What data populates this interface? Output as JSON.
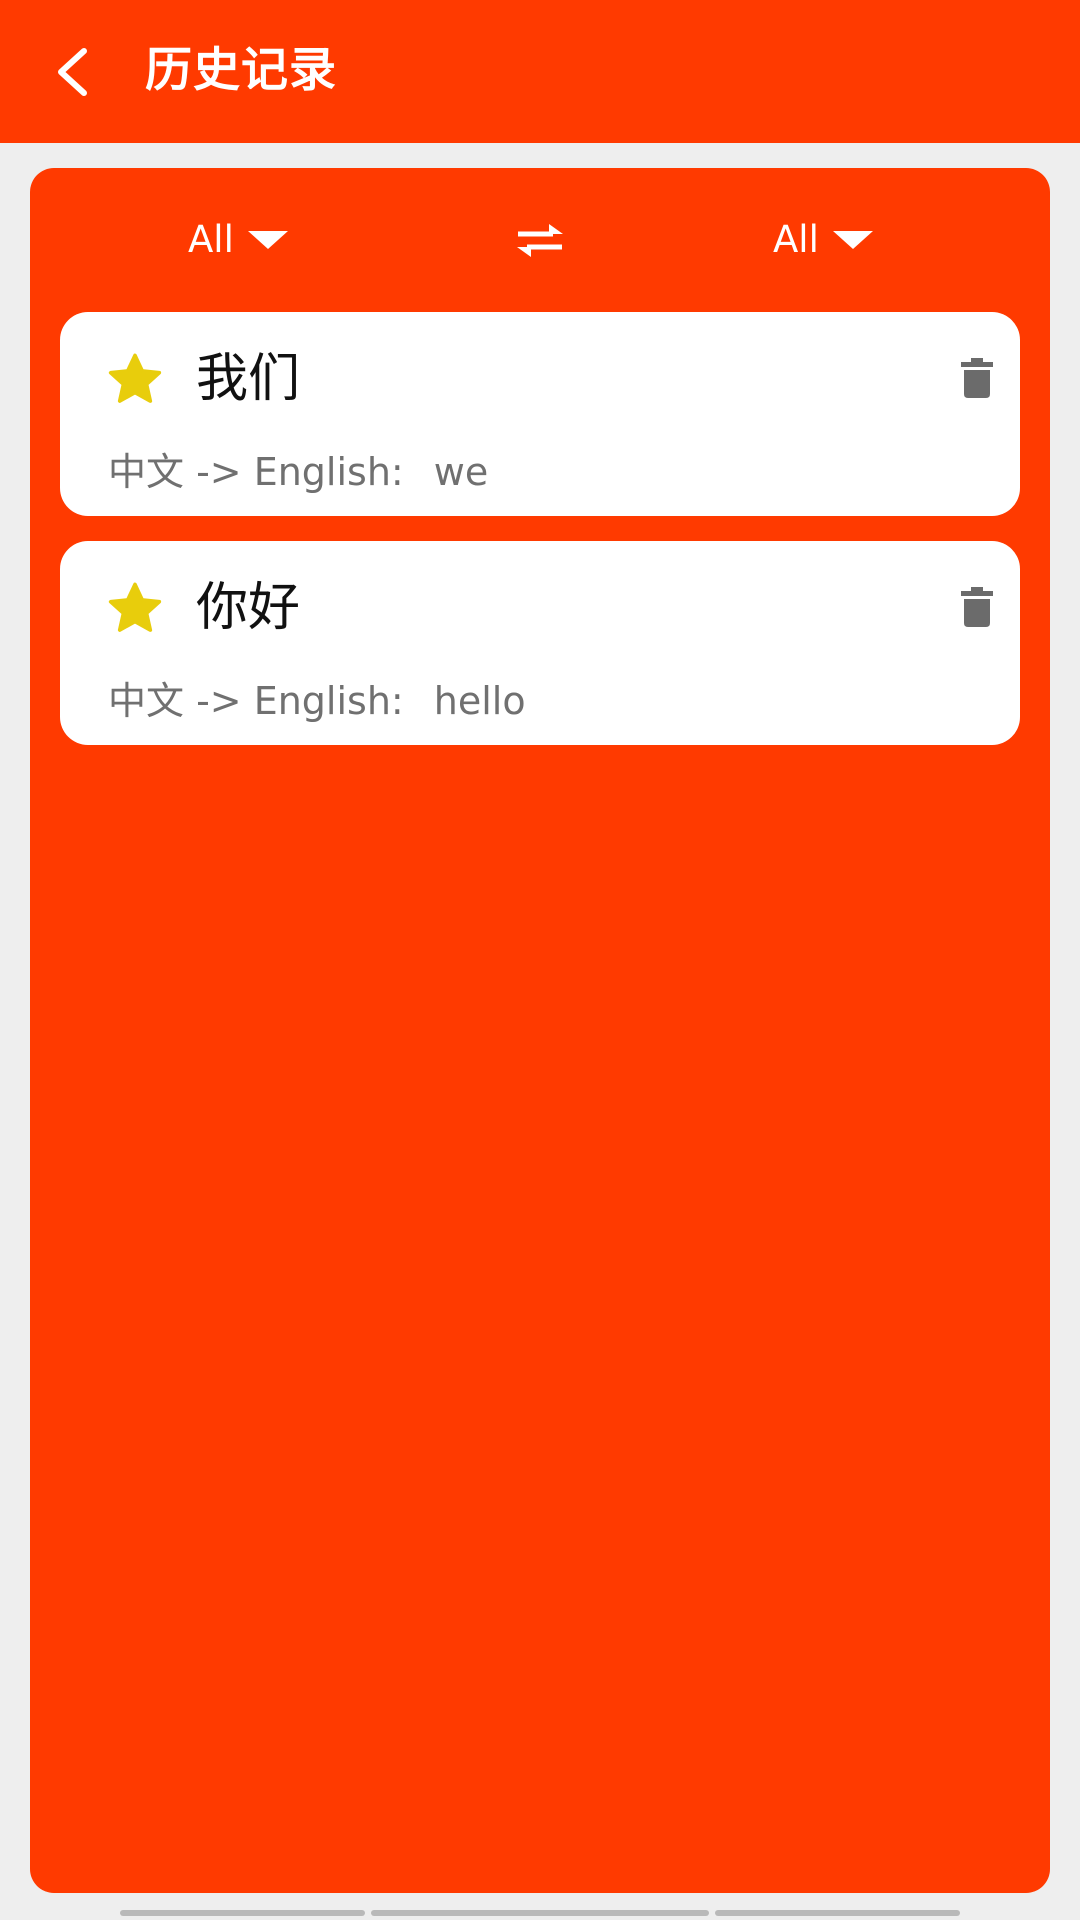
{
  "colors": {
    "accent": "#ff3a00",
    "background": "#eeeeee",
    "card": "#ffffff",
    "star": "#e8cd0c",
    "trash": "#6b6b6b",
    "meta_text": "#707070"
  },
  "header": {
    "back_icon": "chevron-left-icon",
    "title": "历史记录"
  },
  "filter_bar": {
    "source_language": "All",
    "target_language": "All",
    "dropdown_icon": "caret-down-icon",
    "swap_icon": "swap-arrows-icon"
  },
  "history": [
    {
      "starred": true,
      "term": "我们",
      "direction": "中文 -> English:",
      "result": "we"
    },
    {
      "starred": true,
      "term": "你好",
      "direction": "中文 -> English:",
      "result": "hello"
    }
  ]
}
